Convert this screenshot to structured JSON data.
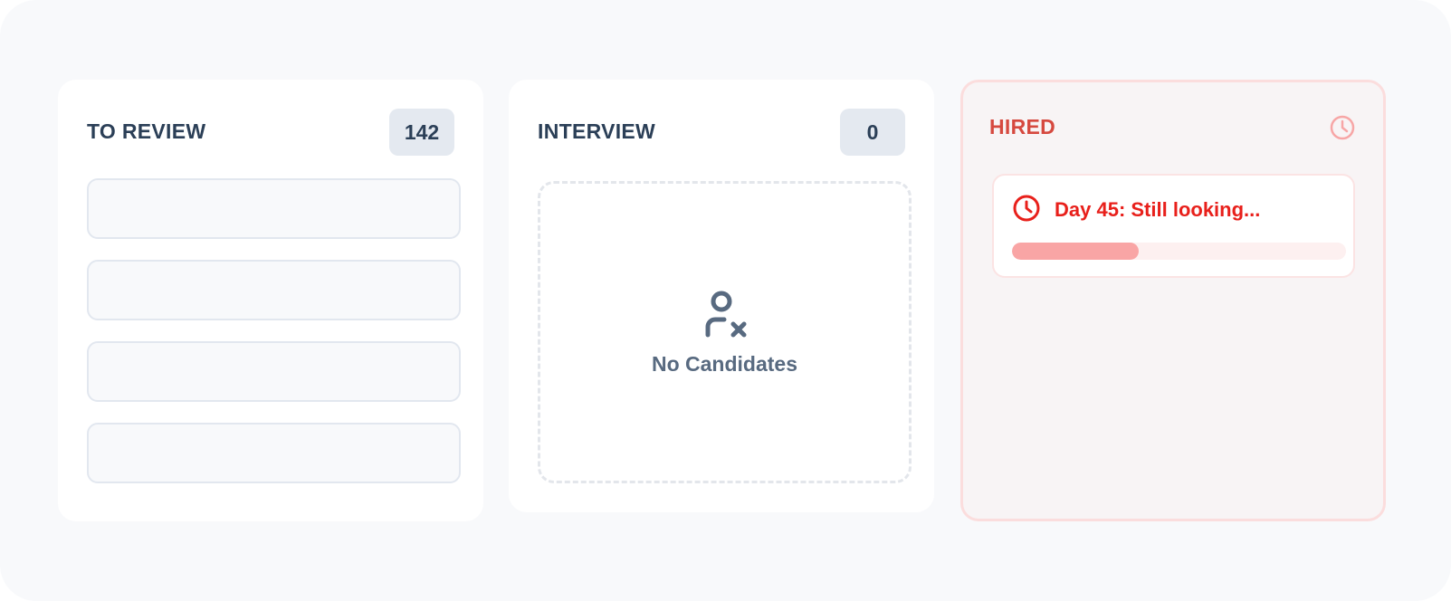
{
  "columns": {
    "to_review": {
      "title": "TO REVIEW",
      "count": "142",
      "placeholder_cards": 4
    },
    "interview": {
      "title": "INTERVIEW",
      "count": "0",
      "empty_state": {
        "icon": "user-x-icon",
        "text": "No Candidates"
      }
    },
    "hired": {
      "title": "HIRED",
      "header_icon": "clock-icon",
      "status_card": {
        "icon": "clock-icon",
        "text": "Day 45: Still looking...",
        "progress": 0.38
      }
    }
  },
  "colors": {
    "background": "#f8f9fb",
    "title_text": "#2b3f57",
    "badge_bg": "#e4e9f0",
    "hired_accent": "#d6493f",
    "alert_red": "#e8201b",
    "progress_fill": "#f9a5a5"
  }
}
